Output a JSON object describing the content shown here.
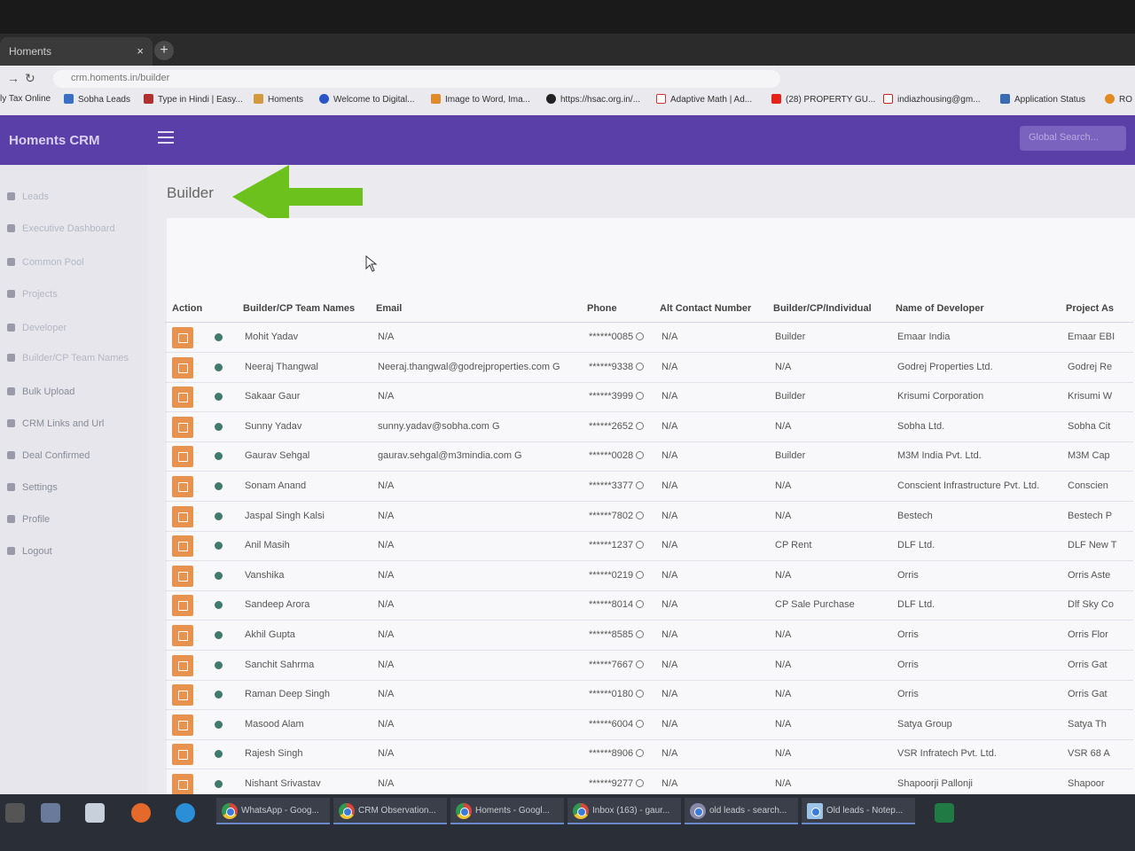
{
  "browser": {
    "tab_title": "Homents",
    "url": "crm.homents.in/builder",
    "bookmarks": [
      "ly Tax Online",
      "Sobha Leads",
      "Type in Hindi | Easy...",
      "Homents",
      "Welcome to Digital...",
      "Image to Word, Ima...",
      "https://hsac.org.in/...",
      "Adaptive Math | Ad...",
      "(28) PROPERTY GU...",
      "indiazhousing@gm...",
      "Application Status",
      "RO"
    ]
  },
  "app": {
    "brand": "Homents CRM",
    "search_placeholder": "Global Search..."
  },
  "sidebar": {
    "items": [
      "Leads",
      "Executive Dashboard",
      "Common Pool",
      "Projects",
      "Developer",
      "Builder/CP Team Names",
      "Bulk Upload",
      "CRM Links and Url",
      "Deal Confirmed",
      "Settings",
      "Profile",
      "Logout"
    ]
  },
  "page": {
    "title": "Builder"
  },
  "table": {
    "headers": [
      "Action",
      "Builder/CP Team Names",
      "Email",
      "Phone",
      "Alt Contact Number",
      "Builder/CP/Individual",
      "Name of Developer",
      "Project As"
    ],
    "rows": [
      {
        "name": "Mohit Yadav",
        "email": "N/A",
        "phone": "******0085",
        "alt": "N/A",
        "type": "Builder",
        "developer": "Emaar India",
        "project": "Emaar EBI"
      },
      {
        "name": "Neeraj Thangwal",
        "email": "Neeraj.thangwal@godrejproperties.com G",
        "phone": "******9338",
        "alt": "N/A",
        "type": "N/A",
        "developer": "Godrej Properties Ltd.",
        "project": "Godrej Re"
      },
      {
        "name": "Sakaar Gaur",
        "email": "N/A",
        "phone": "******3999",
        "alt": "N/A",
        "type": "Builder",
        "developer": "Krisumi Corporation",
        "project": "Krisumi W"
      },
      {
        "name": "Sunny Yadav",
        "email": "sunny.yadav@sobha.com G",
        "phone": "******2652",
        "alt": "N/A",
        "type": "N/A",
        "developer": "Sobha Ltd.",
        "project": "Sobha Cit"
      },
      {
        "name": "Gaurav Sehgal",
        "email": "gaurav.sehgal@m3mindia.com G",
        "phone": "******0028",
        "alt": "N/A",
        "type": "Builder",
        "developer": "M3M India Pvt. Ltd.",
        "project": "M3M Cap"
      },
      {
        "name": "Sonam Anand",
        "email": "N/A",
        "phone": "******3377",
        "alt": "N/A",
        "type": "N/A",
        "developer": "Conscient Infrastructure Pvt. Ltd.",
        "project": "Conscien"
      },
      {
        "name": "Jaspal Singh Kalsi",
        "email": "N/A",
        "phone": "******7802",
        "alt": "N/A",
        "type": "N/A",
        "developer": "Bestech",
        "project": "Bestech P"
      },
      {
        "name": "Anil Masih",
        "email": "N/A",
        "phone": "******1237",
        "alt": "N/A",
        "type": "CP Rent",
        "developer": "DLF Ltd.",
        "project": "DLF New T"
      },
      {
        "name": "Vanshika",
        "email": "N/A",
        "phone": "******0219",
        "alt": "N/A",
        "type": "N/A",
        "developer": "Orris",
        "project": "Orris Aste"
      },
      {
        "name": "Sandeep Arora",
        "email": "N/A",
        "phone": "******8014",
        "alt": "N/A",
        "type": "CP Sale Purchase",
        "developer": "DLF Ltd.",
        "project": "Dlf Sky Co"
      },
      {
        "name": "Akhil Gupta",
        "email": "N/A",
        "phone": "******8585",
        "alt": "N/A",
        "type": "N/A",
        "developer": "Orris",
        "project": "Orris Flor"
      },
      {
        "name": "Sanchit Sahrma",
        "email": "N/A",
        "phone": "******7667",
        "alt": "N/A",
        "type": "N/A",
        "developer": "Orris",
        "project": "Orris Gat"
      },
      {
        "name": "Raman Deep Singh",
        "email": "N/A",
        "phone": "******0180",
        "alt": "N/A",
        "type": "N/A",
        "developer": "Orris",
        "project": "Orris Gat"
      },
      {
        "name": "Masood Alam",
        "email": "N/A",
        "phone": "******6004",
        "alt": "N/A",
        "type": "N/A",
        "developer": "Satya Group",
        "project": "Satya Th"
      },
      {
        "name": "Rajesh Singh",
        "email": "N/A",
        "phone": "******8906",
        "alt": "N/A",
        "type": "N/A",
        "developer": "VSR Infratech Pvt. Ltd.",
        "project": "VSR 68 A"
      },
      {
        "name": "Nishant Srivastav",
        "email": "N/A",
        "phone": "******9277",
        "alt": "N/A",
        "type": "N/A",
        "developer": "Shapoorji Pallonji",
        "project": "Shapoor"
      }
    ]
  },
  "taskbar": {
    "apps": [
      "WhatsApp - Goog...",
      "CRM Observation...",
      "Homents - Googl...",
      "Inbox (163) - gaur...",
      "old leads - search...",
      "Old leads - Notep..."
    ]
  },
  "colors": {
    "header": "#5b3fa8",
    "edit_button": "#e8924f",
    "arrow": "#6cc11c",
    "status_dot": "#3f7a6a"
  }
}
